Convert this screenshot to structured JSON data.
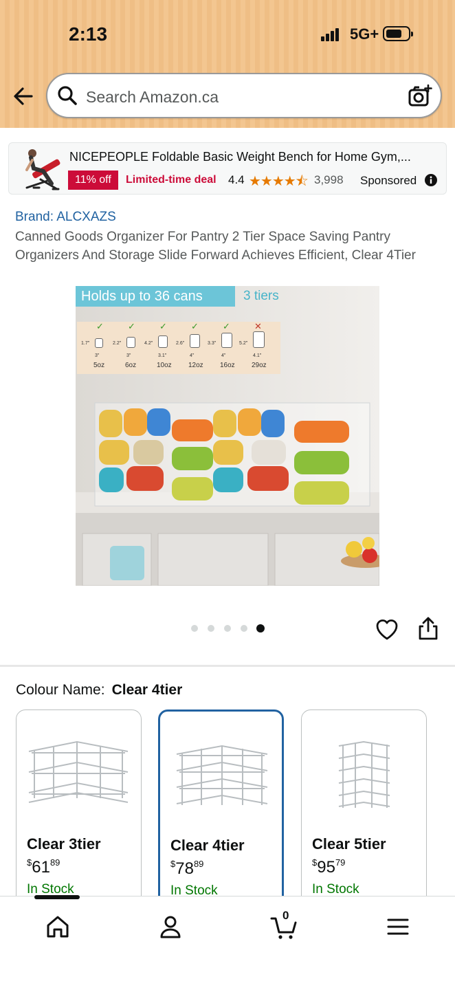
{
  "status_bar": {
    "time": "2:13",
    "network": "5G+"
  },
  "search": {
    "placeholder": "Search Amazon.ca"
  },
  "sponsored_ad": {
    "title": "NICEPEOPLE Foldable Basic Weight Bench for Home Gym,...",
    "discount": "11% off",
    "deal_label": "Limited-time deal",
    "rating": "4.4",
    "rating_stars": 4.4,
    "review_count": "3,998",
    "sponsored_label": "Sponsored"
  },
  "product": {
    "brand": "Brand: ALCXAZS",
    "title": "Canned Goods Organizer For Pantry 2 Tier Space Saving Pantry Organizers And Storage Slide Forward Achieves Efficient, Clear 4Tier",
    "image": {
      "tag_capacity": "Holds up to 36 cans",
      "tag_tiers": "3 tiers",
      "can_sizes": [
        {
          "height": "1.7\"",
          "width": "3\"",
          "oz": "5oz",
          "fits": true
        },
        {
          "height": "2.2\"",
          "width": "3\"",
          "oz": "6oz",
          "fits": true
        },
        {
          "height": "4.2\"",
          "width": "3.1\"",
          "oz": "10oz",
          "fits": true
        },
        {
          "height": "2.6\"",
          "width": "4\"",
          "oz": "12oz",
          "fits": true
        },
        {
          "height": "3.3\"",
          "width": "4\"",
          "oz": "16oz",
          "fits": true
        },
        {
          "height": "5.2\"",
          "width": "4.1\"",
          "oz": "29oz",
          "fits": false
        }
      ]
    },
    "carousel": {
      "total": 5,
      "active_index": 4
    }
  },
  "colour": {
    "label": "Colour Name:",
    "selected": "Clear 4tier",
    "options": [
      {
        "name": "Clear 3tier",
        "currency": "$",
        "price_whole": "61",
        "price_fraction": "89",
        "stock": "In Stock"
      },
      {
        "name": "Clear 4tier",
        "currency": "$",
        "price_whole": "78",
        "price_fraction": "89",
        "stock": "In Stock"
      },
      {
        "name": "Clear 5tier",
        "currency": "$",
        "price_whole": "95",
        "price_fraction": "79",
        "stock": "In Stock"
      }
    ]
  },
  "bottom_nav": {
    "cart_count": "0",
    "items": [
      "home-icon",
      "account-icon",
      "cart-icon",
      "menu-icon"
    ]
  },
  "colors": {
    "link": "#2162a1",
    "deal_red": "#cc0c39",
    "in_stock": "#007600",
    "star": "#e67a00",
    "header_bg": "#f3c690"
  }
}
